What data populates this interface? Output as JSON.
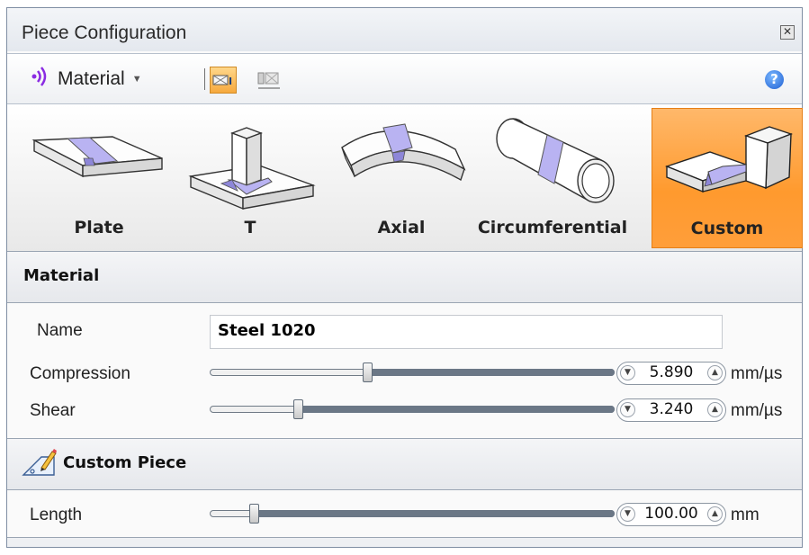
{
  "window": {
    "title": "Piece Configuration"
  },
  "toolbar": {
    "material_label": "Material"
  },
  "pieces": [
    {
      "label": "Plate",
      "selected": false
    },
    {
      "label": "T",
      "selected": false
    },
    {
      "label": "Axial",
      "selected": false
    },
    {
      "label": "Circumferential",
      "selected": false
    },
    {
      "label": "Custom",
      "selected": true
    }
  ],
  "material": {
    "heading": "Material",
    "name_label": "Name",
    "name_value": "Steel 1020",
    "compression": {
      "label": "Compression",
      "value": "5.890",
      "unit": "mm/µs",
      "level": 0.39
    },
    "shear": {
      "label": "Shear",
      "value": "3.240",
      "unit": "mm/µs",
      "level": 0.22
    }
  },
  "custom_piece": {
    "heading": "Custom Piece",
    "length": {
      "label": "Length",
      "value": "100.00",
      "unit": "mm",
      "level": 0.11
    }
  },
  "colors": {
    "accent": "#ff9a2e",
    "weld": "#b9b3f2"
  }
}
